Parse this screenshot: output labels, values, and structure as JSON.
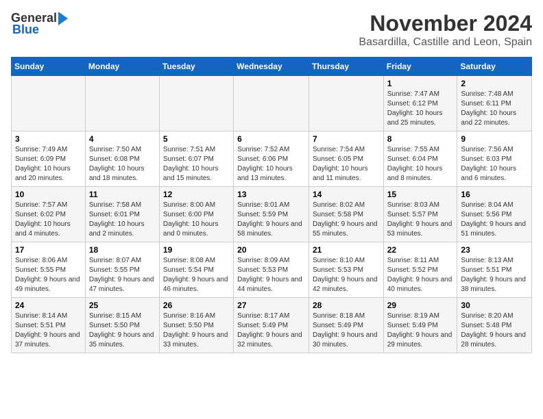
{
  "header": {
    "logo_general": "General",
    "logo_blue": "Blue",
    "month_title": "November 2024",
    "location": "Basardilla, Castille and Leon, Spain"
  },
  "weekdays": [
    "Sunday",
    "Monday",
    "Tuesday",
    "Wednesday",
    "Thursday",
    "Friday",
    "Saturday"
  ],
  "weeks": [
    [
      {
        "day": "",
        "info": ""
      },
      {
        "day": "",
        "info": ""
      },
      {
        "day": "",
        "info": ""
      },
      {
        "day": "",
        "info": ""
      },
      {
        "day": "",
        "info": ""
      },
      {
        "day": "1",
        "info": "Sunrise: 7:47 AM\nSunset: 6:12 PM\nDaylight: 10 hours and 25 minutes."
      },
      {
        "day": "2",
        "info": "Sunrise: 7:48 AM\nSunset: 6:11 PM\nDaylight: 10 hours and 22 minutes."
      }
    ],
    [
      {
        "day": "3",
        "info": "Sunrise: 7:49 AM\nSunset: 6:09 PM\nDaylight: 10 hours and 20 minutes."
      },
      {
        "day": "4",
        "info": "Sunrise: 7:50 AM\nSunset: 6:08 PM\nDaylight: 10 hours and 18 minutes."
      },
      {
        "day": "5",
        "info": "Sunrise: 7:51 AM\nSunset: 6:07 PM\nDaylight: 10 hours and 15 minutes."
      },
      {
        "day": "6",
        "info": "Sunrise: 7:52 AM\nSunset: 6:06 PM\nDaylight: 10 hours and 13 minutes."
      },
      {
        "day": "7",
        "info": "Sunrise: 7:54 AM\nSunset: 6:05 PM\nDaylight: 10 hours and 11 minutes."
      },
      {
        "day": "8",
        "info": "Sunrise: 7:55 AM\nSunset: 6:04 PM\nDaylight: 10 hours and 8 minutes."
      },
      {
        "day": "9",
        "info": "Sunrise: 7:56 AM\nSunset: 6:03 PM\nDaylight: 10 hours and 6 minutes."
      }
    ],
    [
      {
        "day": "10",
        "info": "Sunrise: 7:57 AM\nSunset: 6:02 PM\nDaylight: 10 hours and 4 minutes."
      },
      {
        "day": "11",
        "info": "Sunrise: 7:58 AM\nSunset: 6:01 PM\nDaylight: 10 hours and 2 minutes."
      },
      {
        "day": "12",
        "info": "Sunrise: 8:00 AM\nSunset: 6:00 PM\nDaylight: 10 hours and 0 minutes."
      },
      {
        "day": "13",
        "info": "Sunrise: 8:01 AM\nSunset: 5:59 PM\nDaylight: 9 hours and 58 minutes."
      },
      {
        "day": "14",
        "info": "Sunrise: 8:02 AM\nSunset: 5:58 PM\nDaylight: 9 hours and 55 minutes."
      },
      {
        "day": "15",
        "info": "Sunrise: 8:03 AM\nSunset: 5:57 PM\nDaylight: 9 hours and 53 minutes."
      },
      {
        "day": "16",
        "info": "Sunrise: 8:04 AM\nSunset: 5:56 PM\nDaylight: 9 hours and 51 minutes."
      }
    ],
    [
      {
        "day": "17",
        "info": "Sunrise: 8:06 AM\nSunset: 5:55 PM\nDaylight: 9 hours and 49 minutes."
      },
      {
        "day": "18",
        "info": "Sunrise: 8:07 AM\nSunset: 5:55 PM\nDaylight: 9 hours and 47 minutes."
      },
      {
        "day": "19",
        "info": "Sunrise: 8:08 AM\nSunset: 5:54 PM\nDaylight: 9 hours and 46 minutes."
      },
      {
        "day": "20",
        "info": "Sunrise: 8:09 AM\nSunset: 5:53 PM\nDaylight: 9 hours and 44 minutes."
      },
      {
        "day": "21",
        "info": "Sunrise: 8:10 AM\nSunset: 5:53 PM\nDaylight: 9 hours and 42 minutes."
      },
      {
        "day": "22",
        "info": "Sunrise: 8:11 AM\nSunset: 5:52 PM\nDaylight: 9 hours and 40 minutes."
      },
      {
        "day": "23",
        "info": "Sunrise: 8:13 AM\nSunset: 5:51 PM\nDaylight: 9 hours and 38 minutes."
      }
    ],
    [
      {
        "day": "24",
        "info": "Sunrise: 8:14 AM\nSunset: 5:51 PM\nDaylight: 9 hours and 37 minutes."
      },
      {
        "day": "25",
        "info": "Sunrise: 8:15 AM\nSunset: 5:50 PM\nDaylight: 9 hours and 35 minutes."
      },
      {
        "day": "26",
        "info": "Sunrise: 8:16 AM\nSunset: 5:50 PM\nDaylight: 9 hours and 33 minutes."
      },
      {
        "day": "27",
        "info": "Sunrise: 8:17 AM\nSunset: 5:49 PM\nDaylight: 9 hours and 32 minutes."
      },
      {
        "day": "28",
        "info": "Sunrise: 8:18 AM\nSunset: 5:49 PM\nDaylight: 9 hours and 30 minutes."
      },
      {
        "day": "29",
        "info": "Sunrise: 8:19 AM\nSunset: 5:49 PM\nDaylight: 9 hours and 29 minutes."
      },
      {
        "day": "30",
        "info": "Sunrise: 8:20 AM\nSunset: 5:48 PM\nDaylight: 9 hours and 28 minutes."
      }
    ]
  ]
}
